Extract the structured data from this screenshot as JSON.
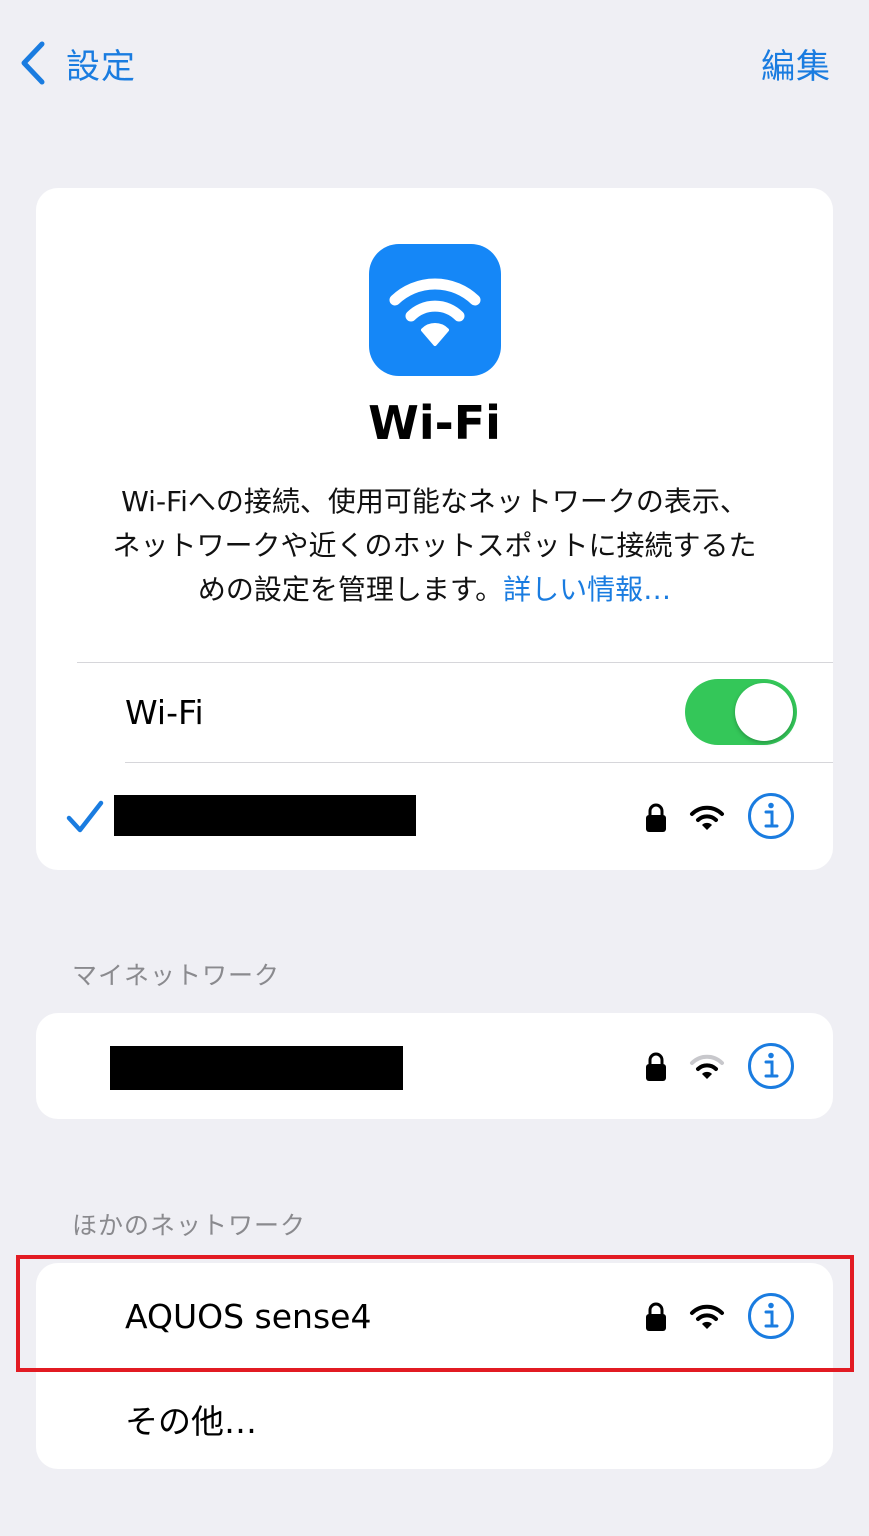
{
  "nav": {
    "back_label": "設定",
    "edit_label": "編集"
  },
  "hero": {
    "icon": "wifi-icon",
    "title": "Wi-Fi",
    "description_line1": "Wi-Fiへの接続、使用可能なネットワークの表示、",
    "description_line2": "ネットワークや近くのホットスポットに接続するた",
    "description_line3": "めの設定を管理します。",
    "link_label": "詳しい情報…"
  },
  "wifi_toggle": {
    "label": "Wi-Fi",
    "on": true
  },
  "my_networks_header": "マイネットワーク",
  "other_networks_header": "ほかのネットワーク",
  "other_networks": [
    {
      "name": "AQUOS sense4"
    }
  ],
  "other_label": "その他…",
  "colors": {
    "accent": "#1a7ce0",
    "toggle_on": "#34c759",
    "icon_bg": "#1587f7",
    "highlight": "#e21b23"
  }
}
